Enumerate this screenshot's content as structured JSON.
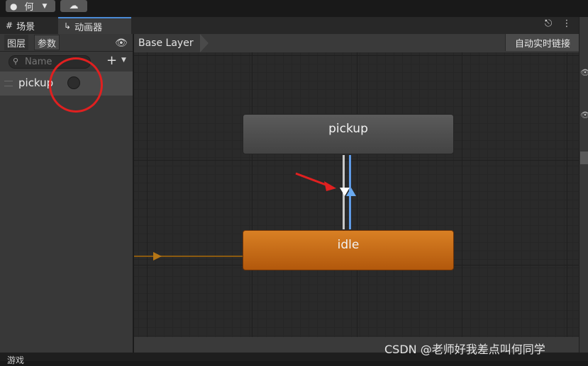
{
  "toolbar": {
    "account_label": "何",
    "account_icon": "account-icon",
    "cloud_icon": "cloud-icon"
  },
  "tabs": {
    "scene": "场景",
    "animator": "动画器"
  },
  "left_panel": {
    "tab_layers": "图层",
    "tab_parameters": "参数",
    "search_placeholder": "Name",
    "parameters": [
      {
        "name": "pickup",
        "type": "trigger"
      }
    ]
  },
  "graph": {
    "breadcrumb": "Base Layer",
    "live_link_label": "自动实时链接",
    "states": [
      {
        "name": "pickup",
        "default": false
      },
      {
        "name": "idle",
        "default": true
      }
    ],
    "transitions": [
      {
        "from": "pickup",
        "to": "idle",
        "color": "#ffffff"
      },
      {
        "from": "idle",
        "to": "pickup",
        "color": "#6aaaf0"
      }
    ]
  },
  "bottom": {
    "game_tab": "游戏"
  },
  "watermark": "CSDN @老师好我差点叫何同学",
  "colors": {
    "default_state": "#c86a18",
    "state": "#4f4f4f",
    "annotation": "#e02020",
    "selected_tab": "#4a8ad6"
  }
}
